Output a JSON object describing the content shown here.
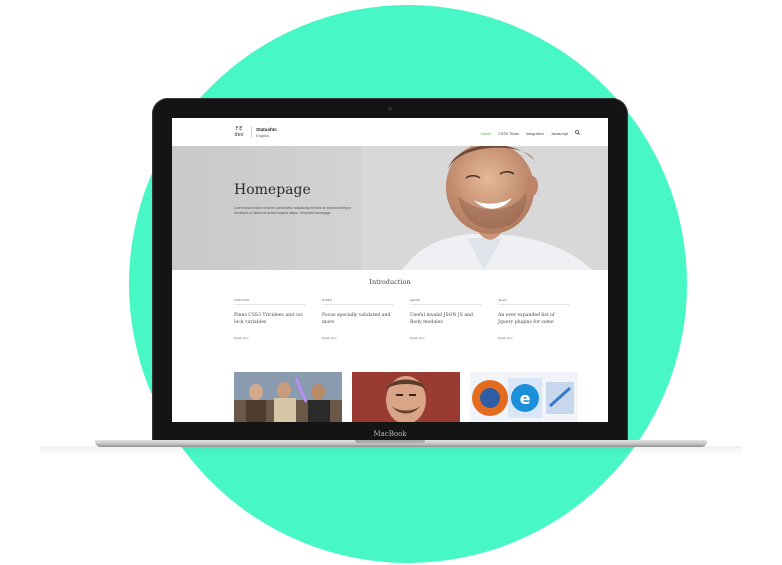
{
  "laptop": {
    "brand": "MacBook"
  },
  "site": {
    "logo": {
      "mark": "F.E\ndev",
      "name": "Statushtc",
      "sub": "English"
    },
    "nav": [
      {
        "label": "Home",
        "active": true
      },
      {
        "label": "CSS3 Tricks",
        "active": false
      },
      {
        "label": "Integration",
        "active": false
      },
      {
        "label": "Javascript",
        "active": false
      }
    ],
    "search_icon": "search-icon",
    "hero": {
      "title": "Homepage",
      "text": "Lorem ipsum dolor sit amet consectetur adipiscing elit sed do eiusmod tempor incididunt ut labore et dolore magna aliqua. Template homepage."
    },
    "section_title": "Introduction",
    "articles": [
      {
        "category": "CSS3-CSS",
        "headline": "Pinns CSS3 Tricidees and css lock variables",
        "more": "Read more"
      },
      {
        "category": "HTML5",
        "headline": "Focus specially validated and more",
        "more": "Read more"
      },
      {
        "category": "Ajax/JS",
        "headline": "Useful invalid JSON JS and Body modules",
        "more": "Read more"
      },
      {
        "category": "Jquery",
        "headline": "An ever expanded list of Jquery plugins for some",
        "more": "Read more"
      }
    ],
    "thumbnails": [
      "movie-scene",
      "portrait-man",
      "browser-logos"
    ]
  },
  "colors": {
    "accent_circle": "#47f7c6",
    "nav_active": "#3fbf2f"
  }
}
